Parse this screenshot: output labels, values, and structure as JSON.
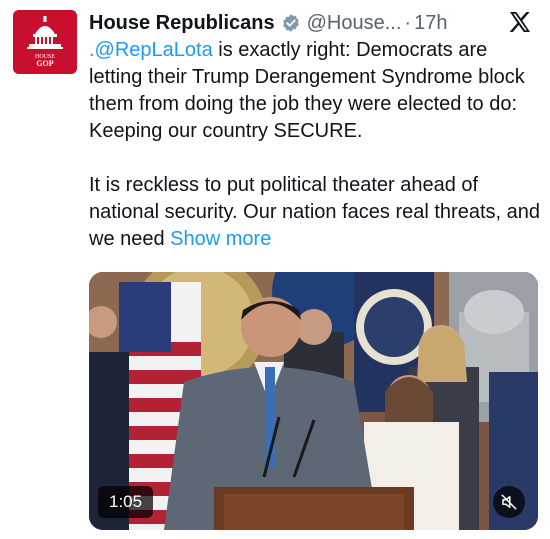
{
  "author": {
    "avatar_label_top": "HOUSE",
    "avatar_label_bottom": "GOP",
    "name": "House Republicans",
    "handle": "@House...",
    "separator": "·",
    "timestamp": "17h"
  },
  "icons": {
    "verified": "verified-badge-icon",
    "platform": "x-logo-icon",
    "mute": "speaker-muted-icon"
  },
  "tweet": {
    "mention": ".@RepLaLota",
    "paragraph1_rest": " is exactly right: Democrats are letting their Trump Derangement Syndrome block them from doing the job they were elected to do: Keeping our country SECURE.",
    "paragraph2": "It is reckless to put political theater ahead of national security. Our nation faces real threats, and we need ",
    "show_more": "Show more"
  },
  "video": {
    "duration": "1:05"
  },
  "colors": {
    "text": "#0f1419",
    "secondary": "#536471",
    "link": "#1d9bf0",
    "brand_red": "#c8102e"
  }
}
